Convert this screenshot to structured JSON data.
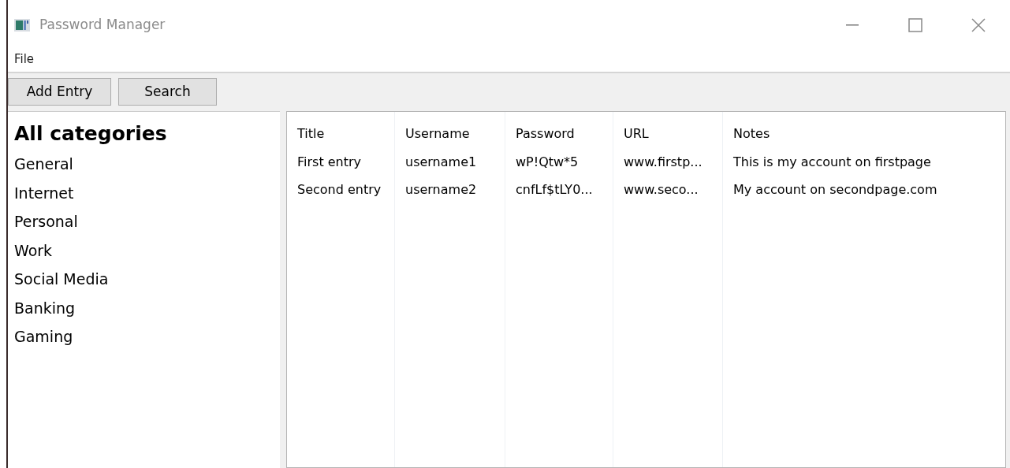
{
  "window": {
    "title": "Password Manager"
  },
  "menu": [
    "File"
  ],
  "toolbar": [
    "Add Entry",
    "Search"
  ],
  "sidebar": {
    "heading": "All categories",
    "items": [
      "General",
      "Internet",
      "Personal",
      "Work",
      "Social Media",
      "Banking",
      "Gaming"
    ]
  },
  "table": {
    "columns": [
      "Title",
      "Username",
      "Password",
      "URL",
      "Notes"
    ],
    "rows": [
      [
        "First entry",
        "username1",
        "wP!Qtw*5",
        "www.firstp...",
        "This is my account on firstpage"
      ],
      [
        "Second entry",
        "username2",
        "cnfLf$tLY0...",
        "www.seco...",
        "My account on secondpage.com"
      ]
    ]
  }
}
